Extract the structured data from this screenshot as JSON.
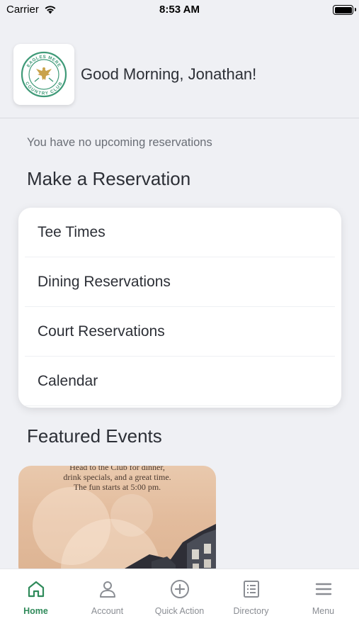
{
  "status_bar": {
    "carrier": "Carrier",
    "time": "8:53 AM"
  },
  "header": {
    "logo_text": {
      "top": "EAGLES MERE",
      "bottom": "COUNTRY CLUB"
    },
    "greeting": "Good Morning, Jonathan!"
  },
  "reservations": {
    "empty_message": "You have no upcoming reservations",
    "title": "Make a Reservation",
    "items": [
      {
        "label": "Tee Times"
      },
      {
        "label": "Dining Reservations"
      },
      {
        "label": "Court Reservations"
      },
      {
        "label": "Calendar"
      }
    ]
  },
  "events": {
    "title": "Featured Events",
    "cards": [
      {
        "lines": [
          "Head to the Club for dinner,",
          "drink specials, and a great time.",
          "The fun starts at 5:00 pm."
        ]
      }
    ]
  },
  "tab_bar": {
    "tabs": [
      {
        "label": "Home",
        "icon": "home-icon",
        "active": true
      },
      {
        "label": "Account",
        "icon": "user-icon",
        "active": false
      },
      {
        "label": "Quick Action",
        "icon": "plus-circle-icon",
        "active": false
      },
      {
        "label": "Directory",
        "icon": "list-icon",
        "active": false
      },
      {
        "label": "Menu",
        "icon": "hamburger-icon",
        "active": false
      }
    ]
  },
  "colors": {
    "accent": "#2f8a5a",
    "logo_green": "#3f9a78",
    "logo_gold": "#c9a24a",
    "background": "#eff0f4"
  }
}
